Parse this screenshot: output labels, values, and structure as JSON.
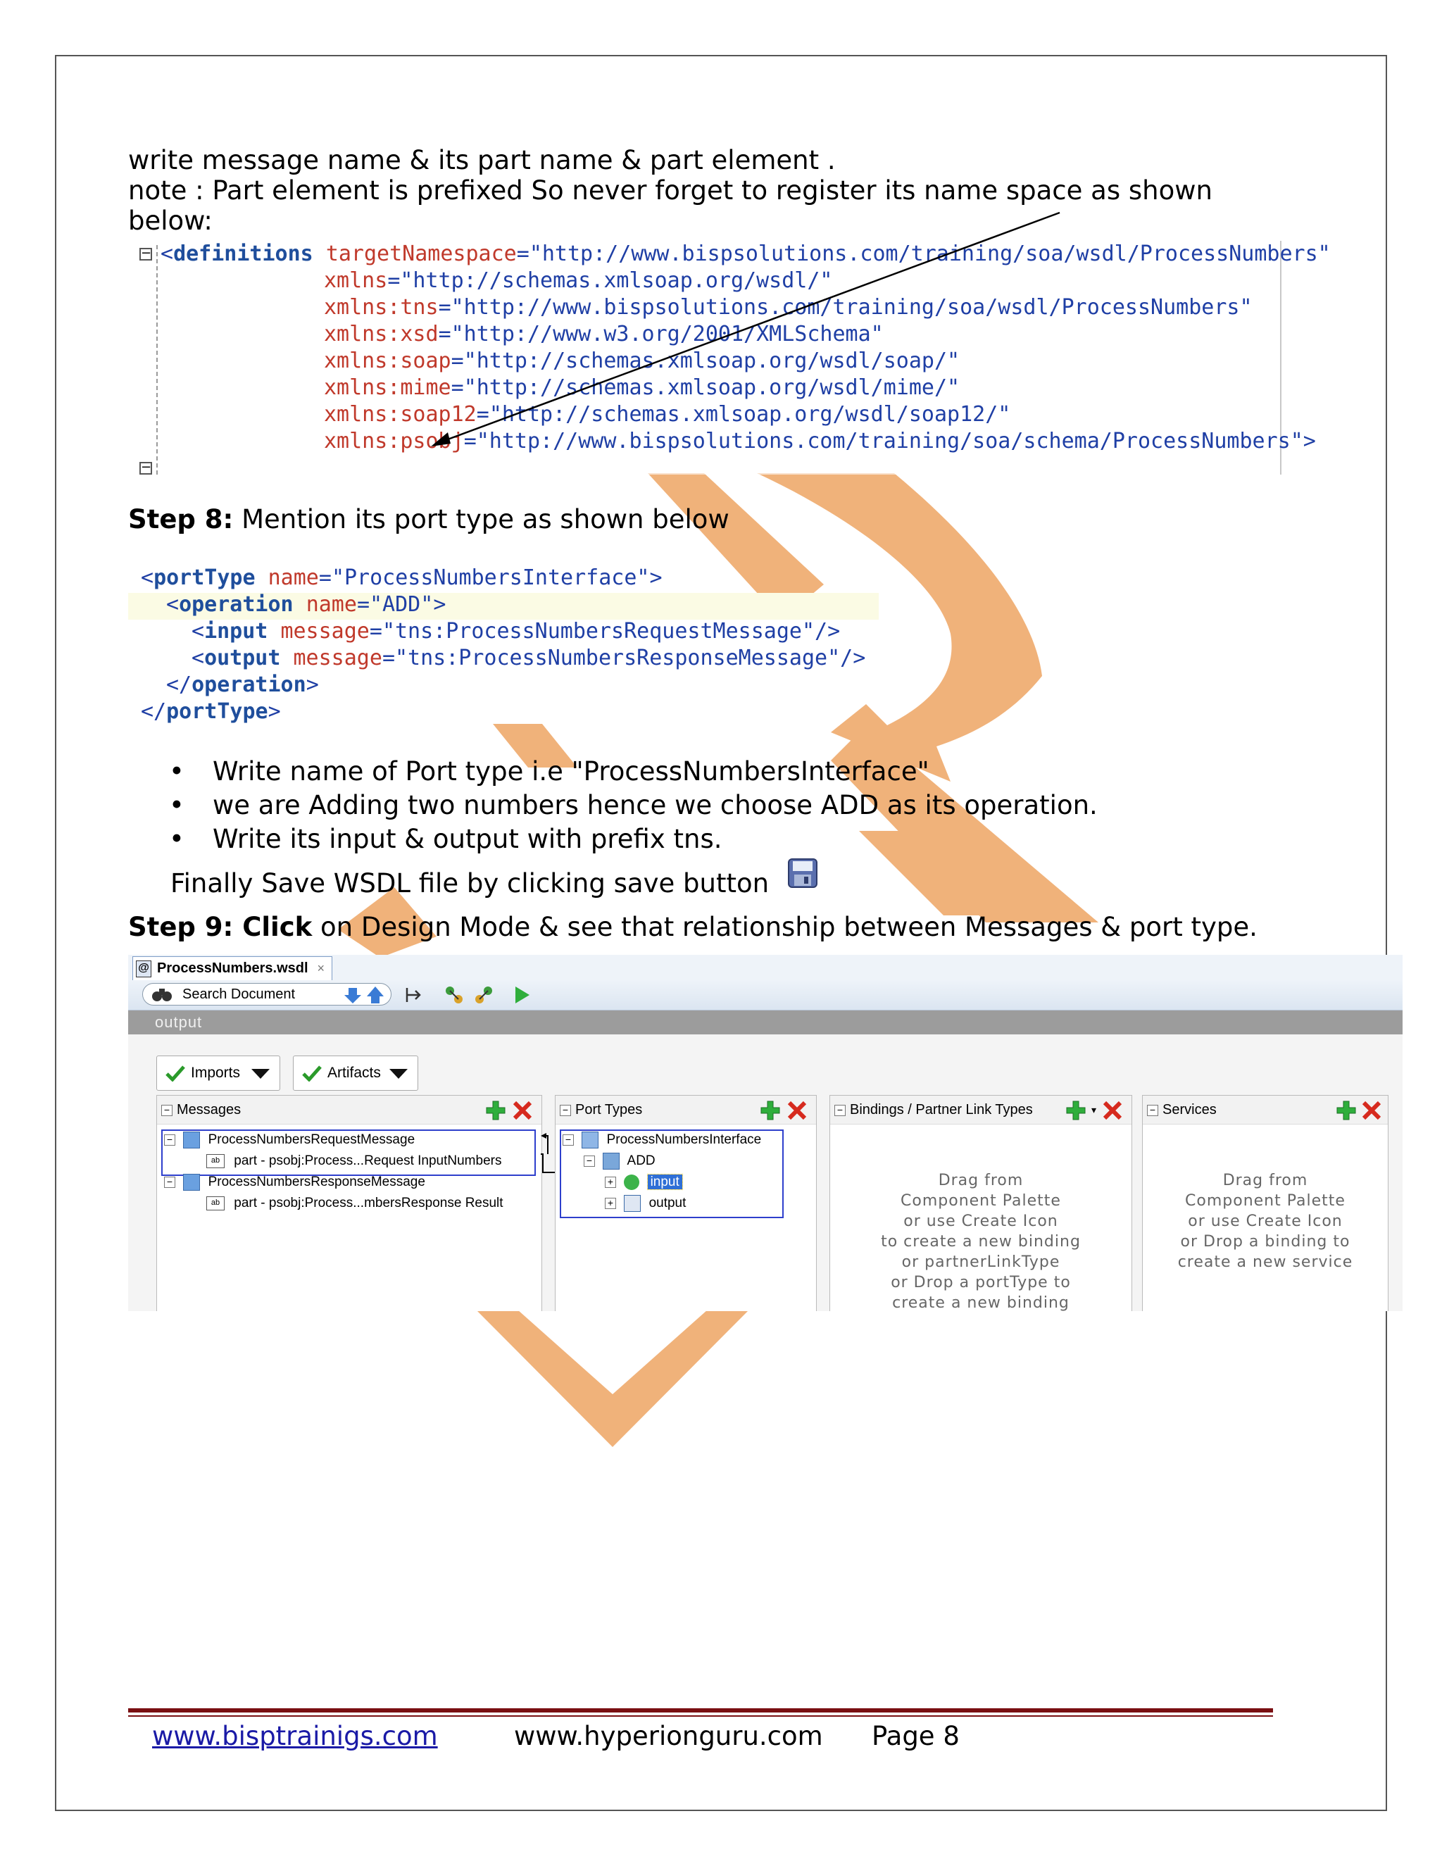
{
  "intro": {
    "line1": "write message name & its part name & part element .",
    "line2": "note :  Part element  is prefixed  So never forget to register its name space  as shown",
    "line3": "below:"
  },
  "code_definitions": {
    "line1_tag": "definitions",
    "line1_attr": "targetNamespace",
    "line1_val": "\"http://www.bispsolutions.com/training/soa/wsdl/ProcessNumbers\"",
    "attrs": [
      {
        "name": "xmlns",
        "value": "\"http://schemas.xmlsoap.org/wsdl/\""
      },
      {
        "name": "xmlns:tns",
        "value": "\"http://www.bispsolutions.com/training/soa/wsdl/ProcessNumbers\""
      },
      {
        "name": "xmlns:xsd",
        "value": "\"http://www.w3.org/2001/XMLSchema\""
      },
      {
        "name": "xmlns:soap",
        "value": "\"http://schemas.xmlsoap.org/wsdl/soap/\""
      },
      {
        "name": "xmlns:mime",
        "value": "\"http://schemas.xmlsoap.org/wsdl/mime/\""
      },
      {
        "name": "xmlns:soap12",
        "value": "\"http://schemas.xmlsoap.org/wsdl/soap12/\""
      },
      {
        "name": "xmlns:psobj",
        "value": "\"http://www.bispsolutions.com/training/soa/schema/ProcessNumbers\">"
      }
    ]
  },
  "step8": {
    "label": "Step 8:",
    "text": " Mention its port type  as shown below"
  },
  "code_porttype": {
    "portType_tag": "portType",
    "portType_attr": "name",
    "portType_val": "\"ProcessNumbersInterface\"",
    "operation_tag": "operation",
    "operation_attr": "name",
    "operation_val": "\"ADD\"",
    "input_tag": "input",
    "input_attr": "message",
    "input_val": "\"tns:ProcessNumbersRequestMessage\"",
    "output_tag": "output",
    "output_attr": "message",
    "output_val": "\"tns:ProcessNumbersResponseMessage\"",
    "close_operation": "operation",
    "close_portType": "portType"
  },
  "bullets": [
    "Write name of Port type i.e  \"ProcessNumbersInterface\"",
    "we are Adding two numbers hence we choose ADD as its operation.",
    "Write its input & output  with prefix tns."
  ],
  "save_line": "Finally Save WSDL file  by clicking save button",
  "step9": {
    "label": "Step 9: Click",
    "text": " on Design Mode & see that relationship between Messages & port type."
  },
  "ide": {
    "tab_title": "ProcessNumbers.wsdl",
    "tab_close": "×",
    "search_placeholder": "Search Document",
    "grey_bar": "output",
    "imports_label": "Imports",
    "artifacts_label": "Artifacts",
    "panels": {
      "messages": {
        "title": "Messages",
        "items": [
          {
            "label": "ProcessNumbersRequestMessage",
            "part": "part - psobj:Process...Request InputNumbers"
          },
          {
            "label": "ProcessNumbersResponseMessage",
            "part": "part - psobj:Process...mbersResponse Result"
          }
        ]
      },
      "port_types": {
        "title": "Port Types",
        "interface": "ProcessNumbersInterface",
        "operation": "ADD",
        "input": "input",
        "output": "output"
      },
      "bindings": {
        "title": "Bindings / Partner Link Types",
        "hint": [
          "Drag from",
          "Component Palette",
          "or use Create Icon",
          "to create a new binding",
          "or partnerLinkType",
          "or Drop a portType to",
          "create a new binding"
        ]
      },
      "services": {
        "title": "Services",
        "hint": [
          "Drag from",
          "Component Palette",
          "or use Create Icon",
          "or Drop a binding to",
          "create a new service"
        ]
      }
    }
  },
  "footer": {
    "link": "www.bisptrainigs.com",
    "site": "www.hyperionguru.com",
    "page": "Page 8"
  },
  "colors": {
    "watermark": "#f0b27a",
    "footer_rule": "#7a0f12",
    "code_tag": "#1f4e9c",
    "code_attr": "#c0392b",
    "code_value": "#1f3fa5",
    "selection": "#2e3fcc"
  }
}
